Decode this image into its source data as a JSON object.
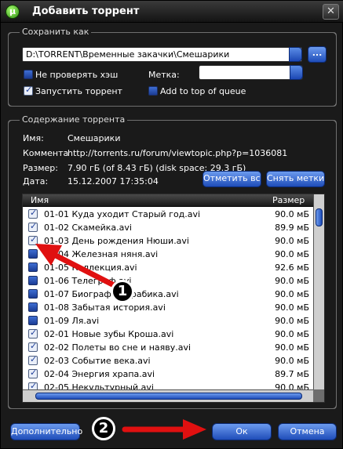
{
  "window": {
    "title": "Добавить торрент",
    "close_glyph": "✕",
    "app_icon_glyph": "µ"
  },
  "save_as": {
    "group_title": "Сохранить как",
    "path_value": "D:\\TORRENT\\Временные закачки\\Смешарики",
    "browse_label": "...",
    "skip_hash_label": "Не проверять хэш",
    "skip_hash_checked": false,
    "start_torrent_label": "Запустить торрент",
    "start_torrent_checked": true,
    "tag_label": "Метка:",
    "tag_value": "",
    "add_top_label": "Add to top of queue",
    "add_top_checked": false
  },
  "content": {
    "group_title": "Содержание торрента",
    "name_key": "Имя:",
    "name_value": "Смешарики",
    "comment_key": "Коммента",
    "comment_value": "http://torrents.ru/forum/viewtopic.php?p=1036081",
    "size_key": "Размер:",
    "size_value": "7.90 гБ (of 8.43 гБ) (disk space: 29.3 гБ)",
    "date_key": "Дата:",
    "date_value": "15.12.2007 17:35:04",
    "select_all_label": "Отметить все",
    "deselect_label": "Снять метки"
  },
  "file_list": {
    "col_name": "Имя",
    "col_size": "Размер",
    "rows": [
      {
        "name": "01-01 Куда уходит Старый год.avi",
        "size": "90.0 мБ",
        "checked": true
      },
      {
        "name": "01-02 Скамейка.avi",
        "size": "89.9 мБ",
        "checked": true
      },
      {
        "name": "01-03 День рождения Нюши.avi",
        "size": "90.0 мБ",
        "checked": true
      },
      {
        "name": "01-04 Железная няня.avi",
        "size": "90.0 мБ",
        "checked": false
      },
      {
        "name": "01-05 Коллекция.avi",
        "size": "92.6 мБ",
        "checked": false
      },
      {
        "name": "01-06 Телеграф.avi",
        "size": "90.0 мБ",
        "checked": false
      },
      {
        "name": "01-07 Биография Крабика.avi",
        "size": "90.0 мБ",
        "checked": false
      },
      {
        "name": "01-08 Забытая история.avi",
        "size": "90.0 мБ",
        "checked": false
      },
      {
        "name": "01-09 Ля.avi",
        "size": "90.0 мБ",
        "checked": false
      },
      {
        "name": "02-01 Новые зубы Кроша.avi",
        "size": "90.0 мБ",
        "checked": true
      },
      {
        "name": "02-02 Полеты во сне и наяву.avi",
        "size": "90.0 мБ",
        "checked": true
      },
      {
        "name": "02-03 Событие века.avi",
        "size": "90.0 мБ",
        "checked": true
      },
      {
        "name": "02-04 Энергия храпа.avi",
        "size": "89.7 мБ",
        "checked": true
      },
      {
        "name": "02-05 Некультурный.avi",
        "size": "90.0 мБ",
        "checked": true
      }
    ]
  },
  "buttons": {
    "advanced": "Дополнительно",
    "ok": "Ок",
    "cancel": "Отмена"
  },
  "annotations": {
    "badge1": "1",
    "badge2": "2",
    "arrow_color": "#e01010"
  }
}
